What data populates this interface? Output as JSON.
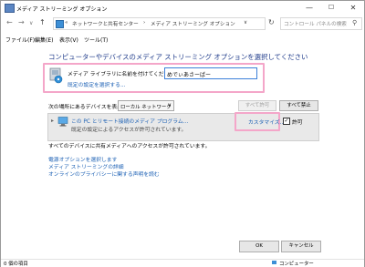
{
  "window": {
    "title": "メディア ストリーミング オプション",
    "controls": {
      "minimize": "—",
      "maximize": "☐",
      "close": "✕"
    }
  },
  "nav": {
    "back": "←",
    "forward": "→",
    "up": "↑",
    "refresh": "↻"
  },
  "address": {
    "crumb_root": "«",
    "crumb1": "ネットワークと共有センター",
    "sep": "›",
    "crumb2": "メディア ストリーミング オプション",
    "dropdown": "∨"
  },
  "search": {
    "placeholder": "コントロール パネルの検索"
  },
  "menu": [
    {
      "label": "ファイル(F)"
    },
    {
      "label": "編集(E)"
    },
    {
      "label": "表示(V)"
    },
    {
      "label": "ツール(T)"
    }
  ],
  "main": {
    "heading": "コンピューターやデバイスのメディア ストリーミング オプションを選択してください",
    "library_name_label": "メディア ライブラリに名前を付けてください:",
    "library_name_value": "めでぃあさーばー",
    "default_settings_link": "既定の設定を選択する...",
    "show_devices_label": "次の場所にあるデバイスを表示:",
    "network_select": "ローカル ネットワーク",
    "allow_all_button": "すべて許可",
    "block_all_button": "すべて禁止",
    "device_title": "この PC とリモート接続のメディア プログラム...",
    "device_subtitle": "既定の設定によるアクセスが許可されています。",
    "customize_link": "カスタマイズ...",
    "allow_label": "許可",
    "allow_checked": true,
    "all_devices_status": "すべてのデバイスに共有メディアへのアクセスが許可されています。",
    "links": [
      "電源オプションを選択します",
      "メディア ストリーミングの詳細",
      "オンラインのプライバシーに関する声明を読む"
    ]
  },
  "footer": {
    "ok_button": "OK",
    "cancel_button": "キャンセル"
  },
  "statusbar": {
    "items_count": "0 個の項目",
    "location": "コンピューター"
  }
}
